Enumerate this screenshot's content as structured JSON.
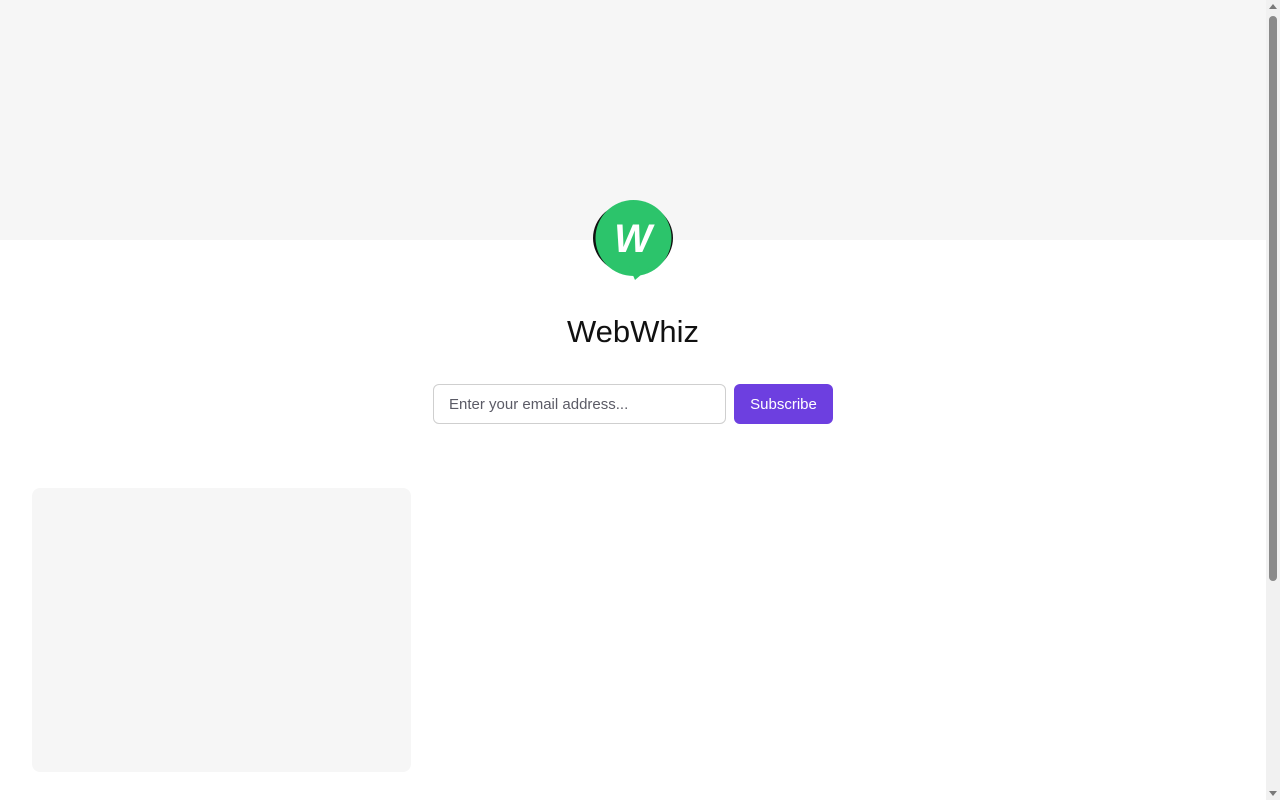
{
  "site": {
    "title": "WebWhiz",
    "logo_letter": "W",
    "logo_color": "#2cc46b"
  },
  "subscribe": {
    "email_placeholder": "Enter your email address...",
    "email_value": "",
    "button_label": "Subscribe",
    "button_color": "#6d3fe0"
  },
  "colors": {
    "hero_background": "#f6f6f6",
    "card_placeholder": "#f6f6f6"
  },
  "icons": {
    "logo": "webwhiz-speech-bubble-logo",
    "scroll_up": "triangle-up",
    "scroll_down": "triangle-down"
  }
}
